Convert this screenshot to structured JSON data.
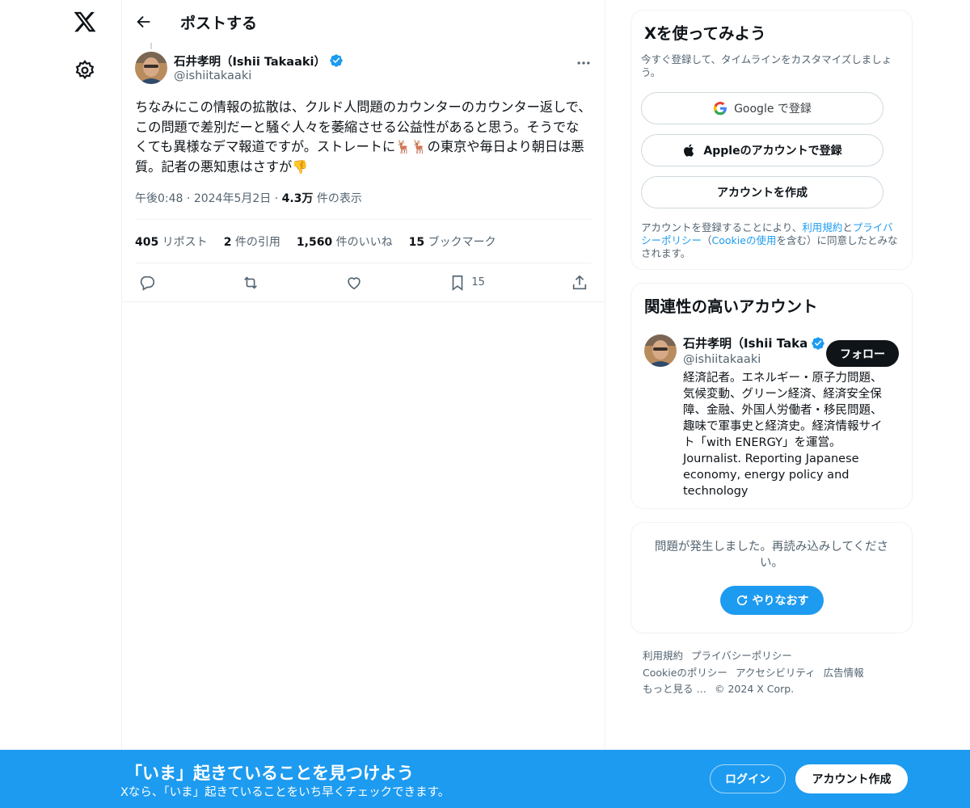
{
  "nav": {
    "logo_icon": "x-logo-icon",
    "settings_icon": "gear-icon"
  },
  "header": {
    "title": "ポストする",
    "back_icon": "arrow-left-icon"
  },
  "post": {
    "author_name": "石井孝明（Ishii Takaaki）",
    "author_handle": "@ishiitakaaki",
    "text_part1": "ちなみにこの情報の拡散は、クルド人問題のカウンターのカウンター返しで、この問題で差別だーと騒ぐ人々を萎縮させる公益性があると思う。そうでなくても異様なデマ報道ですが。ストレートに",
    "emoji_deer": "🦌🦌",
    "text_part2": "の東京や毎日より朝日は悪質。記者の悪知恵はさすが",
    "emoji_thumbs_down": "👎",
    "time": "午後0:48",
    "date": "2024年5月2日",
    "views_count": "4.3万",
    "views_label": "件の表示",
    "stats": {
      "reposts_count": "405",
      "reposts_label": "リポスト",
      "quotes_count": "2",
      "quotes_label": "件の引用",
      "likes_count": "1,560",
      "likes_label": "件のいいね",
      "bookmarks_count": "15",
      "bookmarks_label": "ブックマーク"
    },
    "bookmark_count_action": "15"
  },
  "signup_card": {
    "title": "Xを使ってみよう",
    "subtitle": "今すぐ登録して、タイムラインをカスタマイズしましょう。",
    "google_label": "Google で登録",
    "apple_label": "Appleのアカウントで登録",
    "create_label": "アカウントを作成",
    "legal_prefix": "アカウントを登録することにより、",
    "legal_terms": "利用規約",
    "legal_and": "と",
    "legal_privacy": "プライバシーポリシー",
    "legal_paren_open": "（",
    "legal_cookie": "Cookieの使用",
    "legal_suffix": "を含む）に同意したとみなされます。"
  },
  "related": {
    "title": "関連性の高いアカウント",
    "name": "石井孝明（Ishii Taka",
    "handle": "@ishiitakaaki",
    "follow_label": "フォロー",
    "bio": "経済記者。エネルギー・原子力問題、気候変動、グリーン経済、経済安全保障、金融、外国人労働者・移民問題、趣味で軍事史と経済史。経済情報サイト「with ENERGY」を運営。Journalist. Reporting Japanese economy, energy policy and technology"
  },
  "error_card": {
    "message": "問題が発生しました。再読み込みしてください。",
    "retry_label": "やりなおす"
  },
  "footer": {
    "terms": "利用規約",
    "privacy": "プライバシーポリシー",
    "cookie": "Cookieのポリシー",
    "accessibility": "アクセシビリティ",
    "ads": "広告情報",
    "more": "もっと見る …",
    "copyright": "© 2024 X Corp."
  },
  "bottom_bar": {
    "title": "「いま」起きていることを見つけよう",
    "subtitle": "Xなら、「いま」起きていることをいち早くチェックできます。",
    "login_label": "ログイン",
    "signup_label": "アカウント作成"
  },
  "colors": {
    "accent": "#1d9bf0",
    "text": "#0f1419",
    "muted": "#536471",
    "border": "#eff3f4"
  }
}
